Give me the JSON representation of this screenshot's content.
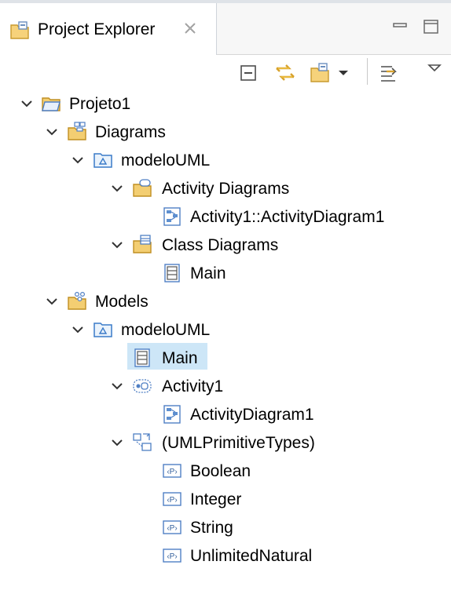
{
  "view": {
    "title": "Project Explorer",
    "icons": {
      "tab": "project-explorer-icon",
      "close": "close-icon",
      "minimize": "minimize-icon",
      "maximize": "maximize-icon"
    }
  },
  "toolbar": {
    "buttons": [
      "collapse-all-icon",
      "link-with-editor-icon",
      "new-icon",
      "dropdown-arrow-icon",
      "focus-icon",
      "view-menu-icon"
    ]
  },
  "tree": {
    "projeto1": "Projeto1",
    "diagrams": "Diagrams",
    "diagrams_model": "modeloUML",
    "activity_diagrams": "Activity Diagrams",
    "activity1_diagram": "Activity1::ActivityDiagram1",
    "class_diagrams": "Class Diagrams",
    "class_main": "Main",
    "models": "Models",
    "models_model": "modeloUML",
    "model_main": "Main",
    "activity1": "Activity1",
    "activity_diagram1": "ActivityDiagram1",
    "primitive_types": "(UMLPrimitiveTypes)",
    "boolean": "Boolean",
    "integer": "Integer",
    "string": "String",
    "unlimited_natural": "UnlimitedNatural"
  },
  "selected_item": "Main",
  "colors": {
    "selection": "#cde6f7",
    "folder": "#e8b64c",
    "blue_icon": "#3a7bc8"
  }
}
